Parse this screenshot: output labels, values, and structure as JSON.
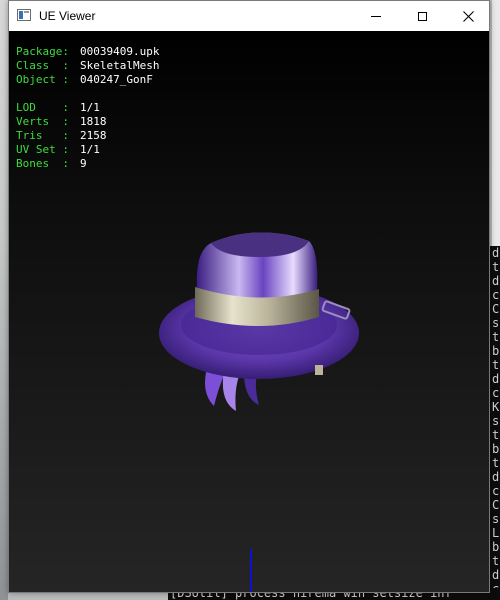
{
  "window": {
    "title": "UE Viewer"
  },
  "info": {
    "rows_top": [
      {
        "key": "Package:",
        "value": "00039409.upk"
      },
      {
        "key": "Class  :",
        "value": "SkeletalMesh"
      },
      {
        "key": "Object :",
        "value": "040247_GonF"
      }
    ],
    "rows_bottom": [
      {
        "key": "LOD    :",
        "value": "1/1"
      },
      {
        "key": "Verts  :",
        "value": "1818"
      },
      {
        "key": "Tris   :",
        "value": "2158"
      },
      {
        "key": "UV Set :",
        "value": "1/1"
      },
      {
        "key": "Bones  :",
        "value": "9"
      }
    ]
  },
  "background_console": {
    "bottom_line": "[DSUtil] process  nirema win setsize  inf",
    "edge_chars": [
      "di",
      "ti",
      "d",
      "ce",
      "C",
      "se",
      "ti",
      "bo",
      "ti",
      "d",
      "ce",
      "K",
      "se",
      "ti",
      "bo",
      "ti",
      "d",
      "ce",
      "C",
      "se",
      "L",
      "bo",
      "ti",
      "d",
      "ce"
    ]
  },
  "colors": {
    "label": "#3ddc3d",
    "value": "#ffffff",
    "viewport_top": "#000000",
    "viewport_bottom": "#252525"
  },
  "icons": [
    "app-icon",
    "minimize-icon",
    "maximize-icon",
    "close-icon"
  ]
}
